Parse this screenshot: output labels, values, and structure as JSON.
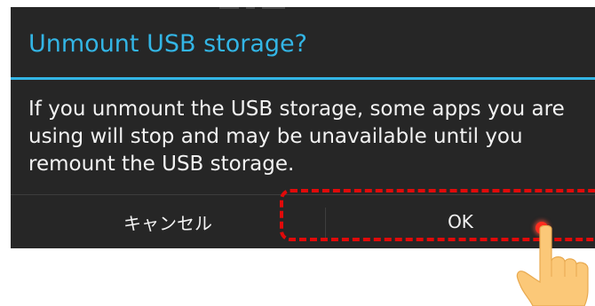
{
  "dialog": {
    "title": "Unmount USB storage?",
    "message": "If you unmount the USB storage, some apps you are using will stop and may be unavailable until you remount the USB storage.",
    "cancel_label": "キャンセル",
    "ok_label": "OK"
  },
  "colors": {
    "dialog_background": "#262626",
    "title_accent": "#33b5e5",
    "text": "#f2f2f2",
    "highlight": "#e10a0a",
    "hand_skin": "#fbc878"
  },
  "annotation": {
    "highlighted_control": "OK",
    "pointer_icon": "pointing-hand-icon"
  }
}
